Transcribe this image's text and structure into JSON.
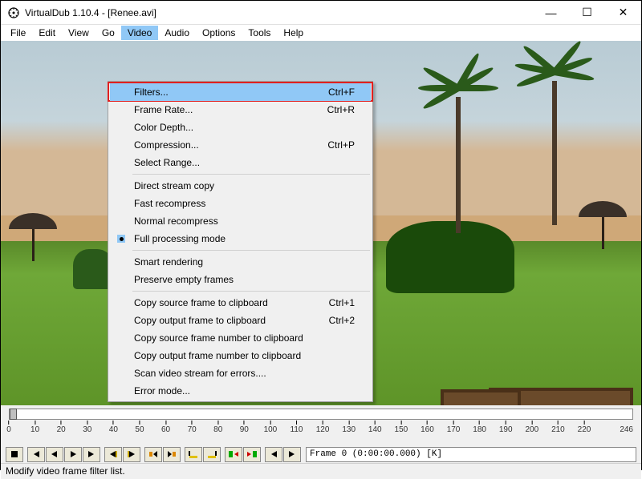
{
  "title": "VirtualDub 1.10.4 - [Renee.avi]",
  "window_controls": {
    "min": "—",
    "max": "☐",
    "close": "✕"
  },
  "menubar": [
    "File",
    "Edit",
    "View",
    "Go",
    "Video",
    "Audio",
    "Options",
    "Tools",
    "Help"
  ],
  "active_menu_index": 4,
  "dropdown": {
    "groups": [
      [
        {
          "label": "Filters...",
          "shortcut": "Ctrl+F",
          "highlighted": true
        },
        {
          "label": "Frame Rate...",
          "shortcut": "Ctrl+R"
        },
        {
          "label": "Color Depth..."
        },
        {
          "label": "Compression...",
          "shortcut": "Ctrl+P"
        },
        {
          "label": "Select Range..."
        }
      ],
      [
        {
          "label": "Direct stream copy"
        },
        {
          "label": "Fast recompress"
        },
        {
          "label": "Normal recompress"
        },
        {
          "label": "Full processing mode",
          "radio": true
        }
      ],
      [
        {
          "label": "Smart rendering"
        },
        {
          "label": "Preserve empty frames"
        }
      ],
      [
        {
          "label": "Copy source frame to clipboard",
          "shortcut": "Ctrl+1"
        },
        {
          "label": "Copy output frame to clipboard",
          "shortcut": "Ctrl+2"
        },
        {
          "label": "Copy source frame number to clipboard"
        },
        {
          "label": "Copy output frame number to clipboard"
        },
        {
          "label": "Scan video stream for errors...."
        },
        {
          "label": "Error mode..."
        }
      ]
    ]
  },
  "ruler": {
    "ticks": [
      0,
      10,
      20,
      30,
      40,
      50,
      60,
      70,
      80,
      90,
      100,
      110,
      120,
      130,
      140,
      150,
      160,
      170,
      180,
      190,
      200,
      210,
      220
    ],
    "end": 246
  },
  "toolbar_icons": [
    "stop",
    "seek-start",
    "step-back",
    "step-fwd",
    "seek-end",
    "prev-key",
    "next-key",
    "prev-scene",
    "next-scene",
    "mark-in",
    "mark-out",
    "goto-in",
    "goto-out",
    "prev-drop",
    "next-drop"
  ],
  "frame_display": "Frame 0 (0:00:00.000) [K]",
  "statusbar": "Modify video frame filter list."
}
